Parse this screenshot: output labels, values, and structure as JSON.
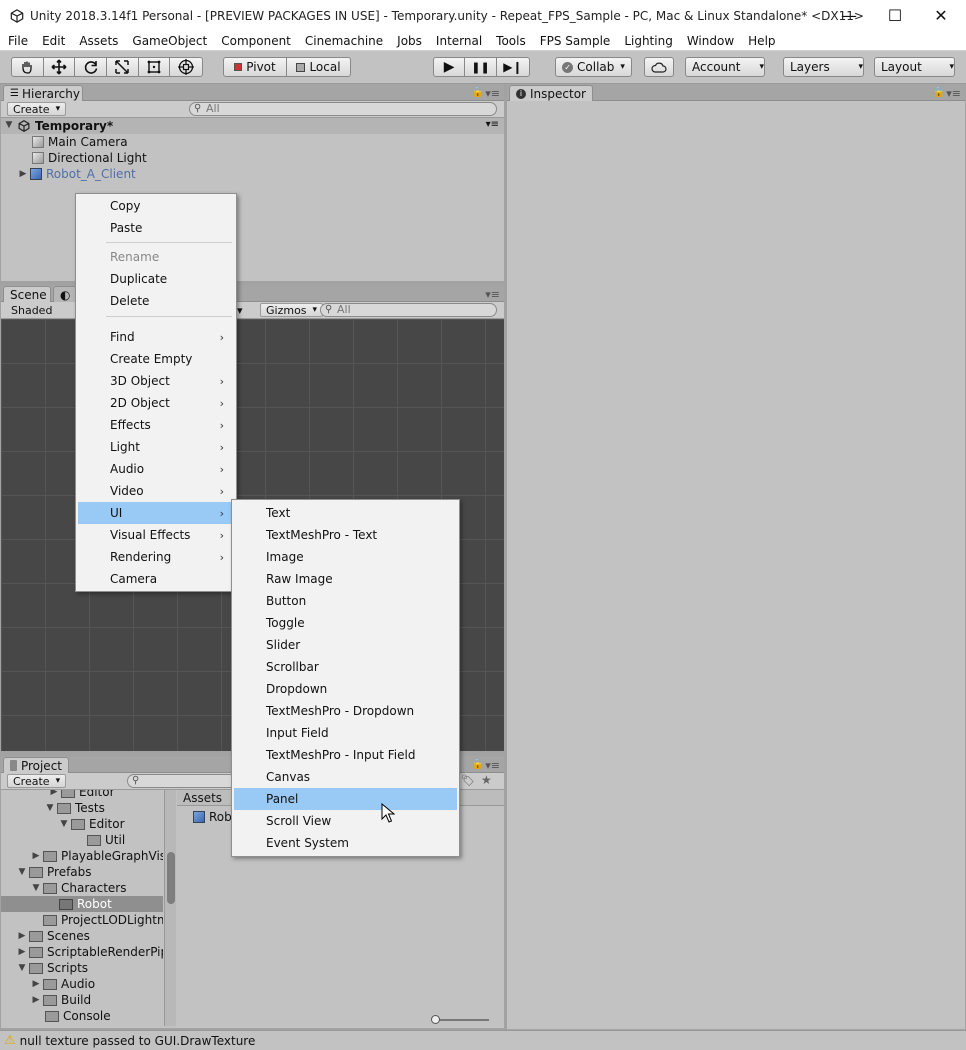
{
  "window": {
    "title": "Unity 2018.3.14f1 Personal - [PREVIEW PACKAGES IN USE] - Temporary.unity - Repeat_FPS_Sample - PC, Mac & Linux Standalone* <DX11>",
    "minimize": "—",
    "maximize": "☐",
    "close": "✕"
  },
  "menubar": [
    "File",
    "Edit",
    "Assets",
    "GameObject",
    "Component",
    "Cinemachine",
    "Jobs",
    "Internal",
    "Tools",
    "FPS Sample",
    "Lighting",
    "Window",
    "Help"
  ],
  "toolbar": {
    "tools": [
      "hand-tool-icon",
      "move-tool-icon",
      "rotate-tool-icon",
      "scale-tool-icon",
      "rect-tool-icon",
      "transform-tool-icon"
    ],
    "pivot": "Pivot",
    "local": "Local",
    "play": "▶",
    "pause": "❚❚",
    "step": "▶❙",
    "collab": "Collab",
    "account": "Account",
    "layers": "Layers",
    "layout": "Layout"
  },
  "hierarchy": {
    "tab": "Hierarchy",
    "create": "Create",
    "search_placeholder": "All",
    "scene": "Temporary*",
    "items": [
      "Main Camera",
      "Directional Light",
      "Robot_A_Client"
    ]
  },
  "inspector": {
    "tab": "Inspector"
  },
  "scene_view": {
    "tab": "Scene",
    "shaded": "Shaded",
    "gizmos": "Gizmos",
    "search_placeholder": "All"
  },
  "project": {
    "tab": "Project",
    "create": "Create",
    "breadcrumb": "Assets",
    "asset_item": "Rob",
    "tree": [
      {
        "label": "Editor"
      },
      {
        "label": "Tests"
      },
      {
        "label": "Editor"
      },
      {
        "label": "Util"
      },
      {
        "label": "PlayableGraphVis"
      },
      {
        "label": "Prefabs"
      },
      {
        "label": "Characters"
      },
      {
        "label": "Robot"
      },
      {
        "label": "ProjectLODLightmap"
      },
      {
        "label": "Scenes"
      },
      {
        "label": "ScriptableRenderPip"
      },
      {
        "label": "Scripts"
      },
      {
        "label": "Audio"
      },
      {
        "label": "Build"
      },
      {
        "label": "Console"
      }
    ]
  },
  "context_menu": {
    "items": [
      {
        "label": "Copy"
      },
      {
        "label": "Paste"
      },
      {
        "label": "Rename"
      },
      {
        "label": "Duplicate"
      },
      {
        "label": "Delete"
      },
      {
        "label": "Find"
      },
      {
        "label": "Create Empty"
      },
      {
        "label": "3D Object"
      },
      {
        "label": "2D Object"
      },
      {
        "label": "Effects"
      },
      {
        "label": "Light"
      },
      {
        "label": "Audio"
      },
      {
        "label": "Video"
      },
      {
        "label": "UI"
      },
      {
        "label": "Visual Effects"
      },
      {
        "label": "Rendering"
      },
      {
        "label": "Camera"
      }
    ]
  },
  "ui_submenu": {
    "items": [
      "Text",
      "TextMeshPro - Text",
      "Image",
      "Raw Image",
      "Button",
      "Toggle",
      "Slider",
      "Scrollbar",
      "Dropdown",
      "TextMeshPro - Dropdown",
      "Input Field",
      "TextMeshPro - Input Field",
      "Canvas",
      "Panel",
      "Scroll View",
      "Event System"
    ],
    "highlighted": "Panel"
  },
  "status": {
    "message": "null texture passed to GUI.DrawTexture"
  },
  "colors": {
    "highlight": "#99c9f5",
    "selected_link": "#4f6fa8",
    "scene_bg": "#474747"
  }
}
